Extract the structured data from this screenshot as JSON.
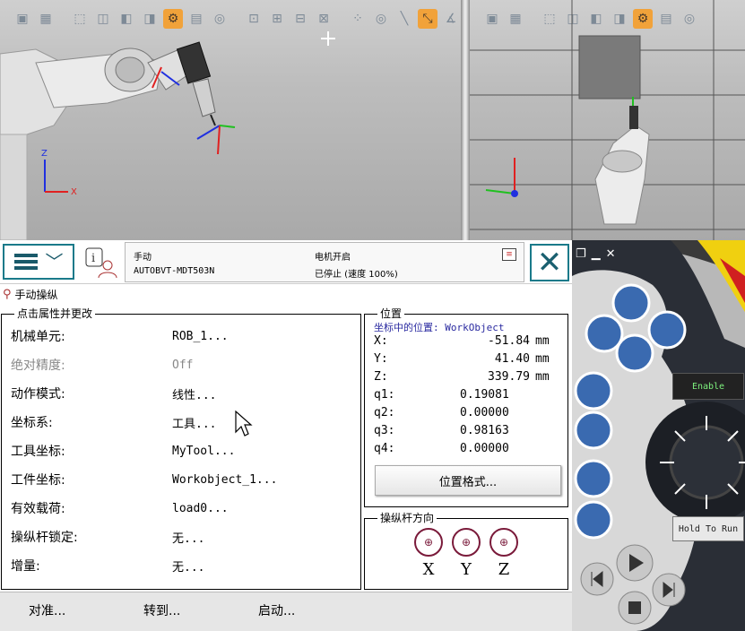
{
  "status": {
    "mode": "手动",
    "system_name": "AUTOBVT-MDT503N",
    "motor_state": "电机开启",
    "run_state": "已停止 (速度 100%)"
  },
  "title": "手动操纵",
  "properties": {
    "group_title": "点击属性并更改",
    "rows": [
      {
        "label": "机械单元:",
        "value": "ROB_1..."
      },
      {
        "label": "绝对精度:",
        "value": "Off"
      },
      {
        "label": "动作模式:",
        "value": "线性..."
      },
      {
        "label": "坐标系:",
        "value": "工具..."
      },
      {
        "label": "工具坐标:",
        "value": "MyTool..."
      },
      {
        "label": "工件坐标:",
        "value": "Workobject_1..."
      },
      {
        "label": "有效载荷:",
        "value": "load0..."
      },
      {
        "label": "操纵杆锁定:",
        "value": "无..."
      },
      {
        "label": "增量:",
        "value": "无..."
      }
    ]
  },
  "position": {
    "group_title": "位置",
    "reference": "坐标中的位置: WorkObject",
    "rows": [
      {
        "key": "X:",
        "value": "-51.84",
        "unit": "mm"
      },
      {
        "key": "Y:",
        "value": "41.40",
        "unit": "mm"
      },
      {
        "key": "Z:",
        "value": "339.79",
        "unit": "mm"
      },
      {
        "key": "q1:",
        "value": "0.19081",
        "unit": ""
      },
      {
        "key": "q2:",
        "value": "0.00000",
        "unit": ""
      },
      {
        "key": "q3:",
        "value": "0.98163",
        "unit": ""
      },
      {
        "key": "q4:",
        "value": "0.00000",
        "unit": ""
      }
    ],
    "format_button": "位置格式..."
  },
  "joystick": {
    "group_title": "操纵杆方向",
    "axes": [
      "X",
      "Y",
      "Z"
    ]
  },
  "bottom_buttons": {
    "align": "对准...",
    "goto": "转到...",
    "start": "启动..."
  },
  "hardware": {
    "enable": "Enable",
    "hold_to_run": "Hold To Run"
  },
  "viewport": {
    "axis_z": "Z",
    "axis_x": "X"
  },
  "colors": {
    "accent": "#1a7a8a",
    "joystick": "#7a1a3a",
    "hw_blue": "#3a6ab0",
    "hw_yellow": "#f0d010"
  }
}
